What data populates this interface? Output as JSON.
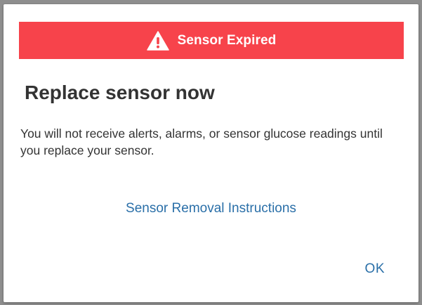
{
  "colors": {
    "banner_bg": "#f7434b",
    "accent": "#2a6fa8",
    "text": "#333333"
  },
  "dialog": {
    "banner": {
      "icon": "warning-triangle-icon",
      "text": "Sensor Expired"
    },
    "title": "Replace sensor now",
    "message": "You will not receive alerts, alarms, or sensor glucose readings until you replace your sensor.",
    "link_label": "Sensor Removal Instructions",
    "ok_label": "OK"
  }
}
